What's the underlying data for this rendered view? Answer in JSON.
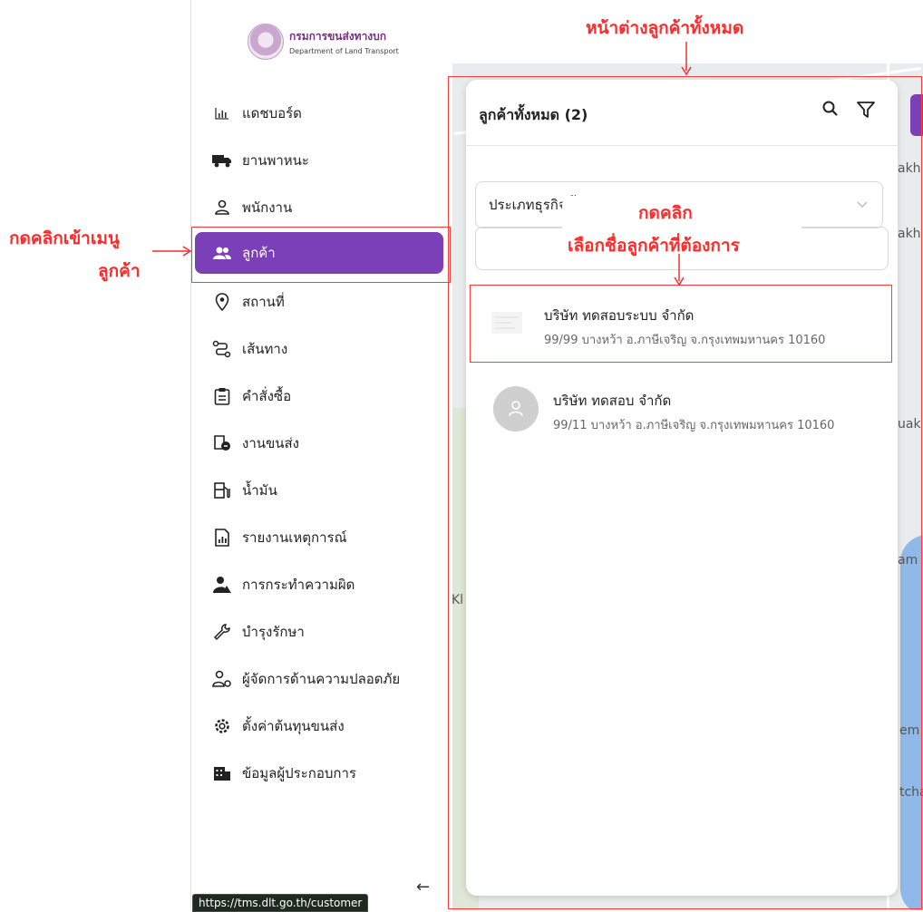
{
  "logo": {
    "th": "กรมการขนส่งทางบก",
    "en": "Department of Land Transport"
  },
  "menu": [
    {
      "label": "แดชบอร์ด",
      "icon": "bar-chart-icon"
    },
    {
      "label": "ยานพาหนะ",
      "icon": "truck-icon"
    },
    {
      "label": "พนักงาน",
      "icon": "person-icon"
    },
    {
      "label": "ลูกค้า",
      "icon": "customers-icon",
      "active": true
    },
    {
      "label": "สถานที่",
      "icon": "location-pin-icon"
    },
    {
      "label": "เส้นทาง",
      "icon": "route-icon"
    },
    {
      "label": "คำสั่งซื้อ",
      "icon": "clipboard-icon"
    },
    {
      "label": "งานขนส่ง",
      "icon": "delivery-job-icon"
    },
    {
      "label": "น้ำมัน",
      "icon": "fuel-icon"
    },
    {
      "label": "รายงานเหตุการณ์",
      "icon": "report-icon"
    },
    {
      "label": "การกระทำความผิด",
      "icon": "violation-icon"
    },
    {
      "label": "บำรุงรักษา",
      "icon": "wrench-icon"
    },
    {
      "label": "ผู้จัดการด้านความปลอดภัย",
      "icon": "safety-manager-icon"
    },
    {
      "label": "ตั้งค่าต้นทุนขนส่ง",
      "icon": "gear-icon"
    },
    {
      "label": "ข้อมูลผู้ประกอบการ",
      "icon": "building-icon"
    }
  ],
  "collapse_arrow": "←",
  "status_url": "https://tms.dlt.go.th/customer",
  "panel": {
    "title": "ลูกค้าทั้งหมด (2)",
    "select_value": "ประเภทธุรกิจทั้งหมด",
    "customers": [
      {
        "name": "บริษัท ทดสอบระบบ จำกัด",
        "address": "99/99 บางหว้า อ.ภาษีเจริญ จ.กรุงเทพมหานคร 10160"
      },
      {
        "name": "บริษัท ทดสอบ จำกัด",
        "address": "99/11 บางหว้า อ.ภาษีเจริญ จ.กรุงเทพมหานคร 10160"
      }
    ]
  },
  "annotations": {
    "top": "หน้าต่างลูกค้าทั้งหมด",
    "menu_line1": "กดคลิกเข้าเมนู",
    "menu_line2": "ลูกค้า",
    "click_line1": "กดคลิก",
    "click_line2": "เลือกชื่อลูกค้าที่ต้องการ"
  },
  "map_labels": [
    "akh",
    "akh",
    "uak",
    "am",
    "em",
    "tcha",
    "Kl"
  ]
}
